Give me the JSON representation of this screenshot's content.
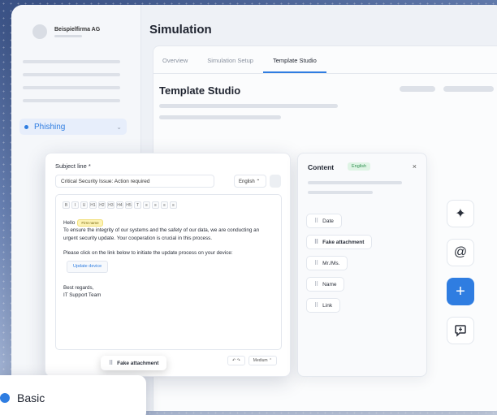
{
  "sidebar": {
    "company": "Beispielfirma AG",
    "nav_active": "Phishing"
  },
  "header": {
    "title": "Simulation",
    "tabs": [
      {
        "label": "Overview",
        "active": false
      },
      {
        "label": "Simulation Setup",
        "active": false
      },
      {
        "label": "Template Studio",
        "active": true
      }
    ],
    "section_title": "Template Studio"
  },
  "editor": {
    "subject_label": "Subject line *",
    "subject_value": "Critical Security Issue: Action required",
    "language": "English",
    "toolbar": [
      "B",
      "I",
      "U",
      "H1",
      "H2",
      "H3",
      "H4",
      "H5",
      "T",
      "≡",
      "≡",
      "≡",
      "≡"
    ],
    "greeting": "Hello",
    "greeting_tag": "First name",
    "paragraph1": "To ensure the integrity of our systems and the safety of our data, we are conducting an urgent security update. Your cooperation is crucial in this process.",
    "paragraph2": "Please click on the link below to initiate the update process on your device:",
    "link_label": "Update device",
    "regards": "Best regards,",
    "signature": "IT Support Team",
    "difficulty": "Medium",
    "dragging_chip": "Fake attachment"
  },
  "content_panel": {
    "title": "Content",
    "language_badge": "English",
    "chips": [
      "Date",
      "Fake attachment",
      "Mr./Ms.",
      "Name",
      "Link"
    ]
  },
  "rail": {
    "icons": [
      "sparkle-icon",
      "at-icon",
      "plus-icon",
      "comment-icon"
    ]
  },
  "badge": {
    "label": "Basic"
  },
  "colors": {
    "accent": "#2f7de1"
  }
}
